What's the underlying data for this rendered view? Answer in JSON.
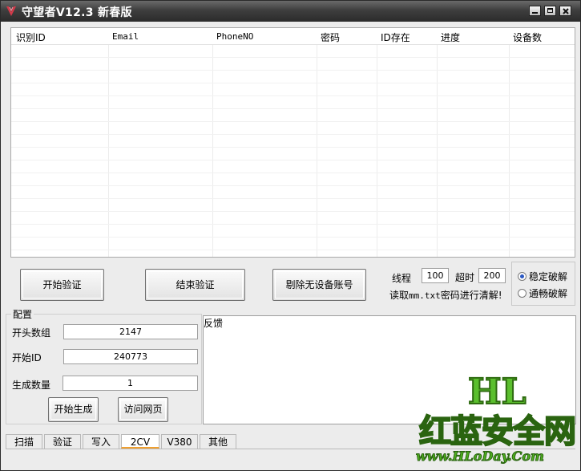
{
  "window": {
    "title": "守望者V12.3 新春版"
  },
  "grid": {
    "columns": [
      "识别ID",
      "Email",
      "PhoneNO",
      "密码",
      "ID存在",
      "进度",
      "设备数"
    ]
  },
  "actions": {
    "start_verify": "开始验证",
    "end_verify": "结束验证",
    "remove_no_device": "剔除无设备账号"
  },
  "settings": {
    "threads_label": "线程",
    "threads_value": "100",
    "timeout_label": "超时",
    "timeout_value": "200",
    "hint_prefix": "读取",
    "hint_file": "mm.txt",
    "hint_suffix": "密码进行清解!",
    "mode_stable": "稳定破解",
    "mode_smooth": "通畅破解",
    "mode_selected": "稳定破解"
  },
  "config": {
    "legend": "配置",
    "head_group_label": "开头数组",
    "head_group_value": "2147",
    "start_id_label": "开始ID",
    "start_id_value": "240773",
    "gen_count_label": "生成数量",
    "gen_count_value": "1",
    "start_gen": "开始生成",
    "visit_web": "访问网页"
  },
  "feedback": {
    "label": "反馈"
  },
  "tabs": [
    "扫描",
    "验证",
    "写入",
    "2CV",
    "V380",
    "其他"
  ],
  "active_tab": "2CV",
  "watermark": {
    "logo": "HL",
    "name": "红蓝安全网",
    "url": "www.HLoDay.Com"
  },
  "colors": {
    "titlebar": "#3e3e3e",
    "radio_dot": "#2b58c2",
    "tab_accent": "#f0a030",
    "watermark": "#4faf1f"
  }
}
